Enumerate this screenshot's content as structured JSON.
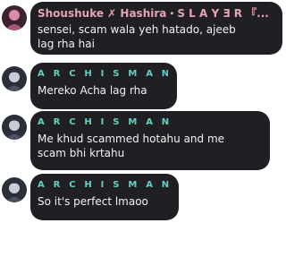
{
  "colors": {
    "bubble": "#1f1f24",
    "first_author": "#e6a3b3",
    "archisman": "#63d1c3",
    "text": "#f2f2f2"
  },
  "messages": [
    {
      "author": "Shoushuke ✗ Hashira・S L A Y Ǝ R 『...",
      "text": "sensei, scam wala yeh hatado, ajeeb\nlag rha hai",
      "avatar_icon": "pink-avatar-icon"
    },
    {
      "author": "A R C H I S M A N",
      "text": "Mereko Acha lag rha",
      "avatar_icon": "dark-avatar-icon"
    },
    {
      "author": "A R C H I S M A N",
      "text": "Me khud scammed hotahu and me\nscam bhi krtahu",
      "avatar_icon": "dark-avatar-icon"
    },
    {
      "author": "A R C H I S M A N",
      "text": "So it's perfect lmaoo",
      "avatar_icon": "dark-avatar-icon"
    }
  ]
}
